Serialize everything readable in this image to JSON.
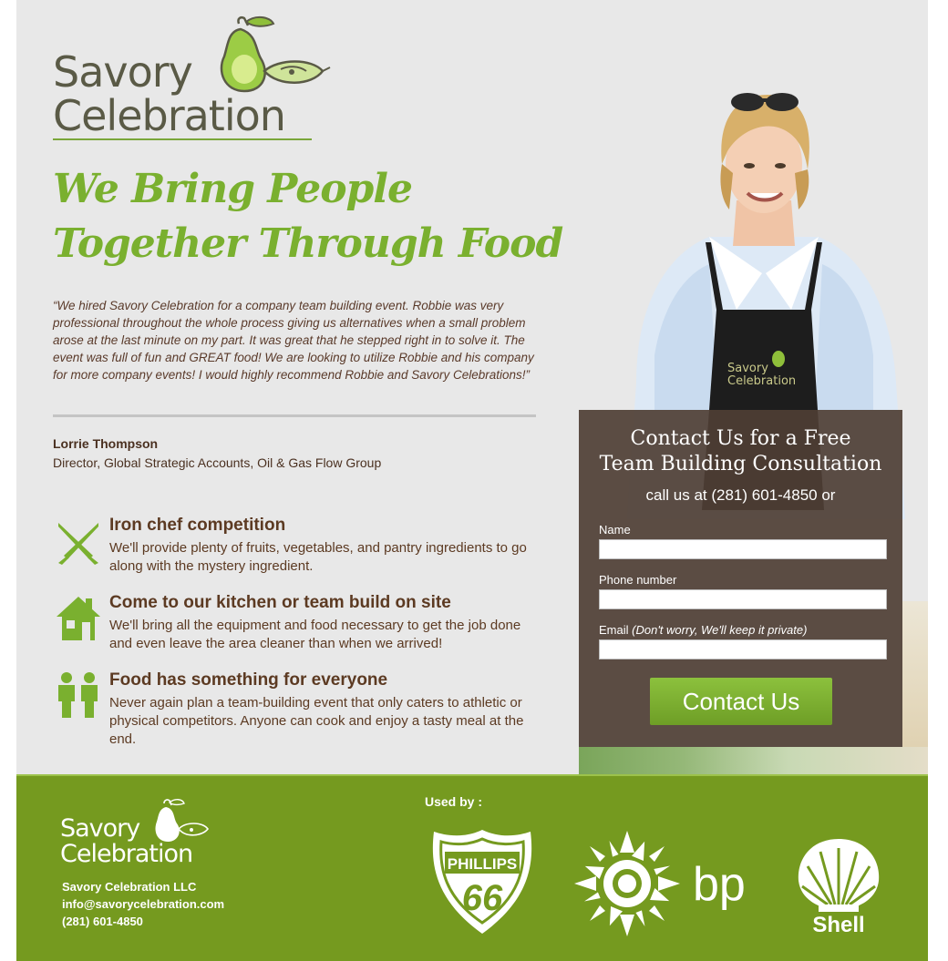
{
  "brand": {
    "logo_line1": "Savory",
    "logo_line2": "Celebration"
  },
  "hero": {
    "headline_line1": "We Bring People",
    "headline_line2": "Together Through Food"
  },
  "testimonial": {
    "quote": "“We hired Savory Celebration for a company team building event. Robbie was very professional throughout the whole process giving us alternatives when a small problem arose at the last minute on my part. It was great that he stepped right in to solve it. The event was full of fun and GREAT food! We are looking to utilize Robbie and his company for more company events! I would highly recommend Robbie and Savory Celebrations!”",
    "author": "Lorrie Thompson",
    "author_title": "Director, Global Strategic Accounts, Oil & Gas Flow Group"
  },
  "features": [
    {
      "icon": "crossed-knives-icon",
      "title": "Iron chef competition",
      "description": "We'll provide plenty of fruits, vegetables, and pantry ingredients to go along with the mystery ingredient."
    },
    {
      "icon": "house-icon",
      "title": "Come to our kitchen or team build on site",
      "description": "We'll bring all the equipment and food necessary to get the job done and even leave the area cleaner than when we arrived!"
    },
    {
      "icon": "people-icon",
      "title": "Food has something for everyone",
      "description": "Never again plan a team-building event that only caters to athletic or physical competitors. Anyone can cook and enjoy a tasty meal at the end."
    }
  ],
  "contact": {
    "title_line1": "Contact Us for a Free",
    "title_line2": "Team Building Consultation",
    "call_text": "call us at (281) 601-4850 or",
    "name_label": "Name",
    "name_value": "",
    "phone_label": "Phone number",
    "phone_value": "",
    "email_label": "Email",
    "email_note": "(Don't worry, We'll keep it private)",
    "email_value": "",
    "submit_label": "Contact Us",
    "apron_logo_line1": "Savory",
    "apron_logo_line2": "Celebration"
  },
  "footer": {
    "company_name": "Savory Celebration LLC",
    "email": "info@savorycelebration.com",
    "phone": "(281) 601-4850",
    "used_by": "Used by :",
    "logos": {
      "phillips_top": "PHILLIPS",
      "phillips_number": "66",
      "bp": "bp",
      "shell": "Shell"
    }
  },
  "colors": {
    "accent_green": "#7ab02f",
    "footer_green": "#759a1f",
    "brown_text": "#5c3a22",
    "contact_box": "#4e3e34"
  }
}
